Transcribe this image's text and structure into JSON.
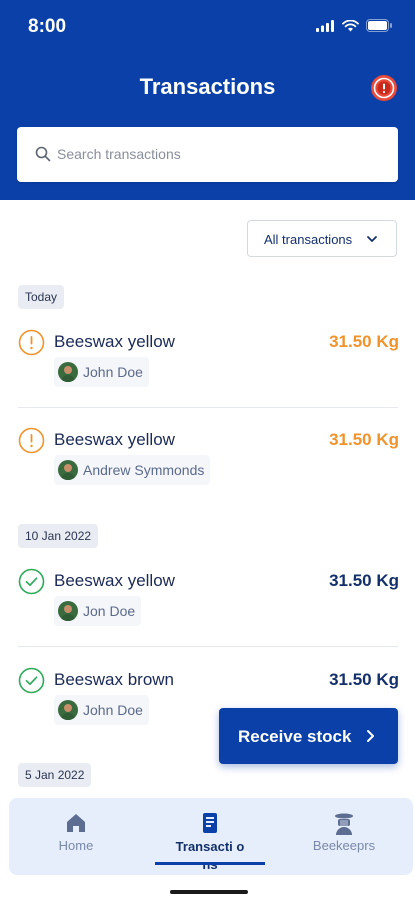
{
  "status_bar": {
    "time": "8:00"
  },
  "header": {
    "title": "Transactions",
    "alarm_icon": "alarm-icon",
    "accent": "#0a40a8"
  },
  "search": {
    "placeholder": "Search transactions"
  },
  "filter": {
    "label": "All transactions"
  },
  "groups": [
    {
      "date": "Today",
      "items": [
        {
          "name": "Beeswax yellow",
          "quantity": "31.50 Kg",
          "person": "John Doe",
          "status": "pending"
        },
        {
          "name": "Beeswax yellow",
          "quantity": "31.50 Kg",
          "person": "Andrew Symmonds",
          "status": "pending"
        }
      ]
    },
    {
      "date": "10 Jan 2022",
      "items": [
        {
          "name": "Beeswax yellow",
          "quantity": "31.50 Kg",
          "person": "Jon Doe",
          "status": "done"
        },
        {
          "name": "Beeswax brown",
          "quantity": "31.50 Kg",
          "person": "John Doe",
          "status": "done"
        }
      ]
    },
    {
      "date": "5 Jan 2022",
      "items": []
    }
  ],
  "fab": {
    "label": "Receive stock"
  },
  "tabs": [
    {
      "label": "Home",
      "icon": "home-icon",
      "active": false
    },
    {
      "label": "Transacti ons",
      "icon": "document-icon",
      "active": true
    },
    {
      "label": "Beekeeprs",
      "icon": "beekeeper-icon",
      "active": false
    }
  ],
  "colors": {
    "pending": "#f0932b",
    "done": "#2dab5a",
    "text": "#14306b",
    "tabbar": "#e6eefb"
  }
}
